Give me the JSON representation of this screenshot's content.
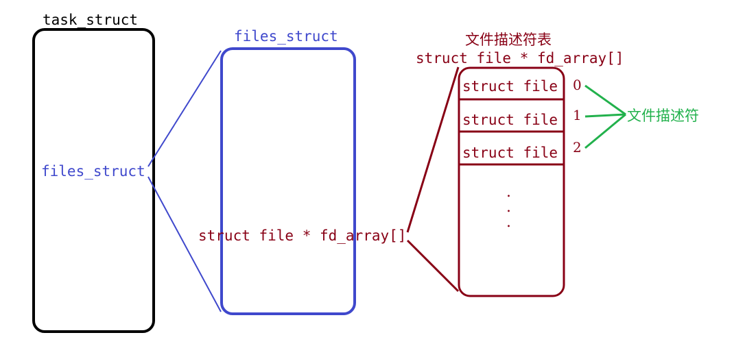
{
  "task_struct": {
    "title": "task_struct",
    "field": "files_struct"
  },
  "files_struct": {
    "title": "files_struct",
    "field": "struct file * fd_array[]"
  },
  "fd_table": {
    "title": "文件描述符表",
    "subtitle": "struct file * fd_array[]",
    "rows": [
      "struct file",
      "struct file",
      "struct file"
    ],
    "indices": [
      "0",
      "1",
      "2"
    ],
    "ellipsis": [
      ".",
      ".",
      "."
    ]
  },
  "descriptor_label": "文件描述符",
  "colors": {
    "black": "#000000",
    "blue": "#3f48cc",
    "maroon": "#880015",
    "green": "#22b14c"
  }
}
